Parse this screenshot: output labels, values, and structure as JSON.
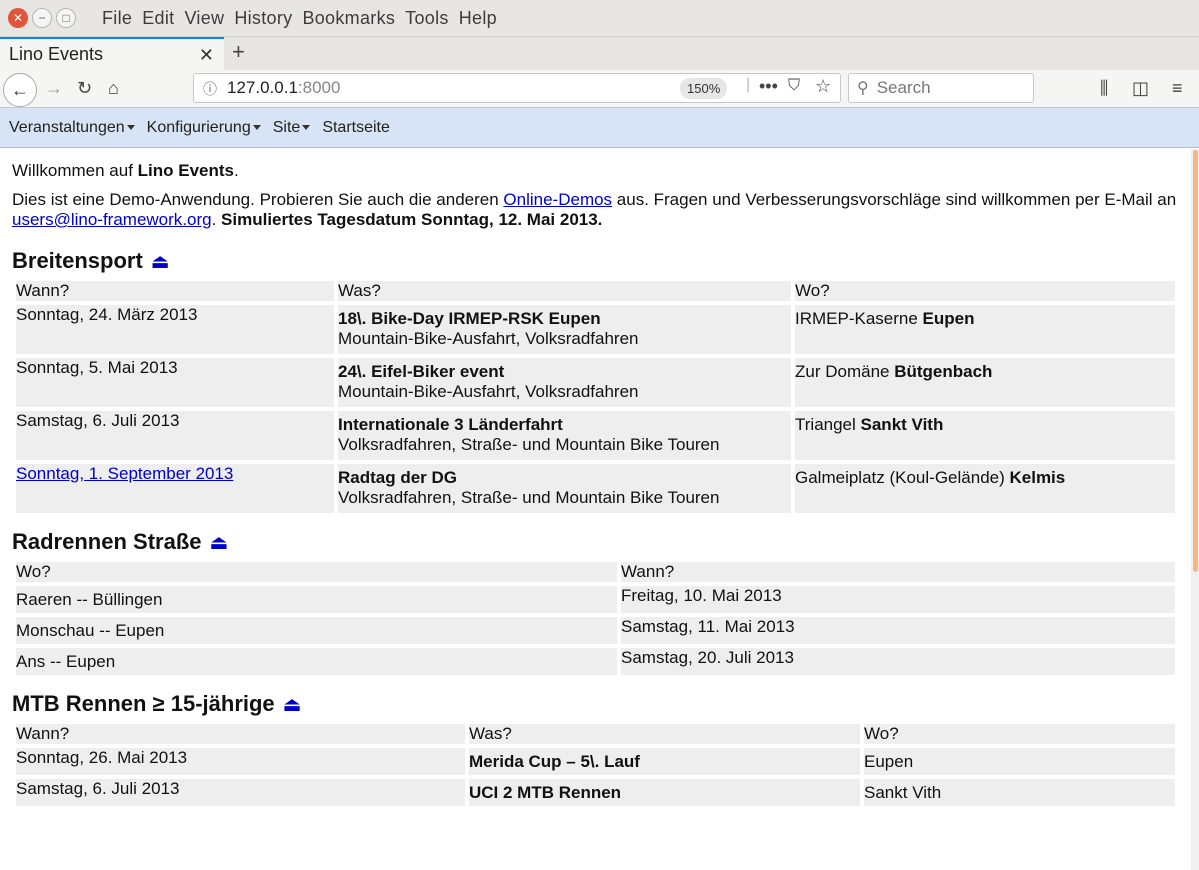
{
  "window": {
    "menu": [
      "File",
      "Edit",
      "View",
      "History",
      "Bookmarks",
      "Tools",
      "Help"
    ]
  },
  "tab": {
    "title": "Lino Events"
  },
  "url": {
    "host": "127.0.0.1",
    "port": ":8000",
    "zoom": "150%",
    "search_placeholder": "Search"
  },
  "lino_menu": [
    {
      "label": "Veranstaltungen",
      "dropdown": true
    },
    {
      "label": "Konfigurierung",
      "dropdown": true
    },
    {
      "label": "Site",
      "dropdown": true
    },
    {
      "label": "Startseite",
      "dropdown": false
    }
  ],
  "welcome": {
    "prefix": "Willkommen auf ",
    "app": "Lino Events",
    "suffix": ".",
    "intro_a": "Dies ist eine Demo-Anwendung. Probieren Sie auch die anderen ",
    "link_demos": "Online-Demos",
    "intro_b": " aus. Fragen und Verbesserungsvorschläge sind willkommen per E-Mail an ",
    "link_email": "users@lino-framework.org",
    "intro_c": ". ",
    "simulated": "Simuliertes Tagesdatum Sonntag, 12. Mai 2013."
  },
  "sections": [
    {
      "title": "Breitensport",
      "headers": [
        "Wann?",
        "Was?",
        "Wo?"
      ],
      "rows": [
        {
          "when": "Sonntag, 24. März 2013",
          "what_title": "18\\. Bike-Day IRMEP-RSK Eupen",
          "what_sub": "Mountain-Bike-Ausfahrt, Volksradfahren",
          "where_place": "IRMEP-Kaserne ",
          "where_city": "Eupen"
        },
        {
          "when": "Sonntag, 5. Mai 2013",
          "what_title": "24\\. Eifel-Biker event",
          "what_sub": "Mountain-Bike-Ausfahrt, Volksradfahren",
          "where_place": "Zur Domäne ",
          "where_city": "Bütgenbach"
        },
        {
          "when": "Samstag, 6. Juli 2013",
          "what_title": "Internationale 3 Länderfahrt",
          "what_sub": "Volksradfahren, Straße- und Mountain Bike Touren",
          "where_place": "Triangel ",
          "where_city": "Sankt Vith"
        },
        {
          "when": "Sonntag, 1. September 2013",
          "what_title": "Radtag der DG",
          "what_sub": "Volksradfahren, Straße- und Mountain Bike Touren",
          "where_place": "Galmeiplatz (Koul-Gelände) ",
          "where_city": "Kelmis"
        }
      ]
    },
    {
      "title": "Radrennen Straße",
      "headers": [
        "Wo?",
        "Wann?"
      ],
      "rows": [
        {
          "where": "Raeren -- Büllingen",
          "when": "Freitag, 10. Mai 2013"
        },
        {
          "where": "Monschau -- Eupen",
          "when": "Samstag, 11. Mai 2013"
        },
        {
          "where": "Ans -- Eupen",
          "when": "Samstag, 20. Juli 2013"
        }
      ]
    },
    {
      "title": "MTB Rennen ≥ 15-jährige",
      "headers": [
        "Wann?",
        "Was?",
        "Wo?"
      ],
      "rows": [
        {
          "when": "Sonntag, 26. Mai 2013",
          "what": "Merida Cup – 5\\. Lauf",
          "where": "Eupen"
        },
        {
          "when": "Samstag, 6. Juli 2013",
          "what": "UCI 2 MTB Rennen",
          "where": "Sankt Vith"
        }
      ]
    }
  ]
}
